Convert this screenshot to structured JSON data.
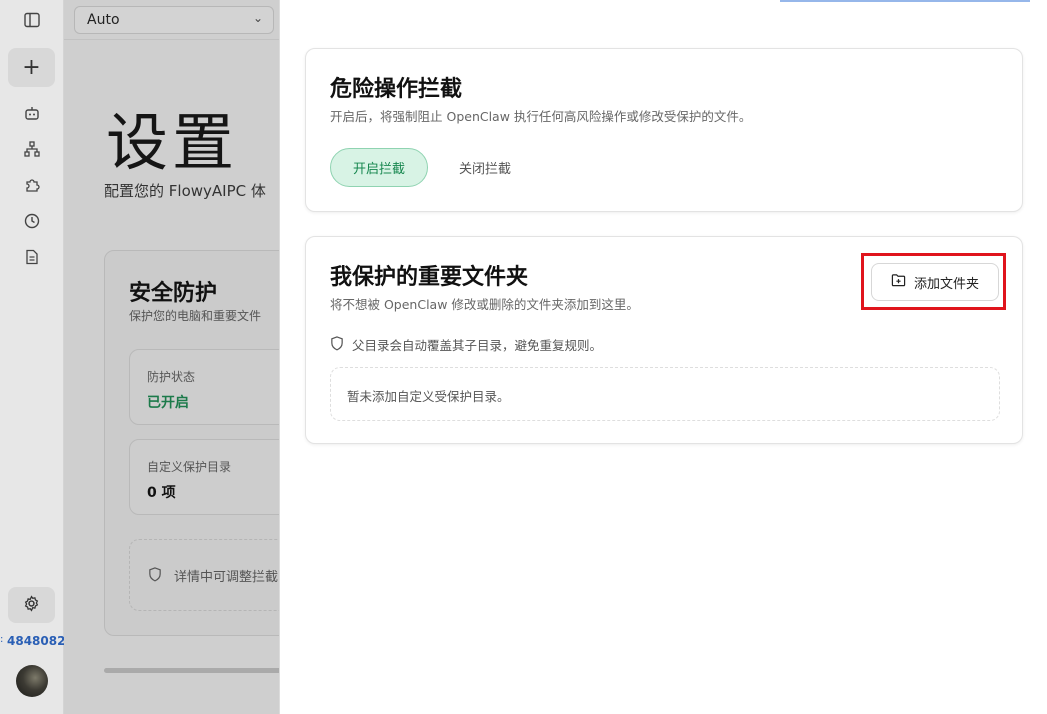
{
  "rail": {
    "new_label": "+",
    "user_id": "4848082",
    "icons": [
      "sidebar-toggle-icon",
      "robot-icon",
      "sitemap-icon",
      "puzzle-icon",
      "clock-icon",
      "document-icon",
      "gear-icon"
    ]
  },
  "topbar": {
    "model_select": "Auto"
  },
  "page": {
    "title": "设置",
    "subtitle": "配置您的 FlowyAIPC 体",
    "security_card": {
      "title": "安全防护",
      "desc": "保护您的电脑和重要文件",
      "status_label": "防护状态",
      "status_value": "已开启",
      "custom_label": "自定义保护目录",
      "custom_value": "0 项",
      "hint": "详情中可调整拦截"
    }
  },
  "drawer": {
    "danger": {
      "title": "危险操作拦截",
      "desc": "开启后，将强制阻止 OpenClaw 执行任何高风险操作或修改受保护的文件。",
      "on_label": "开启拦截",
      "off_label": "关闭拦截"
    },
    "folders": {
      "title": "我保护的重要文件夹",
      "desc": "将不想被 OpenClaw 修改或删除的文件夹添加到这里。",
      "add_label": "添加文件夹",
      "note": "父目录会自动覆盖其子目录，避免重复规则。",
      "empty": "暂未添加自定义受保护目录。"
    }
  },
  "colors": {
    "accent_green": "#17874f",
    "highlight_red": "#e0141c"
  }
}
